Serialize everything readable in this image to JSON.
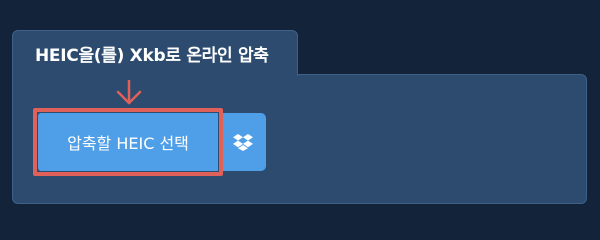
{
  "panel": {
    "title": "HEIC을(를) Xkb로 온라인 압축"
  },
  "upload": {
    "select_label": "압축할 HEIC 선택",
    "dropbox_icon": "dropbox-icon"
  },
  "colors": {
    "background": "#13233a",
    "panel": "#2c4b6e",
    "button": "#4f9fe8",
    "highlight": "#e0605a"
  }
}
